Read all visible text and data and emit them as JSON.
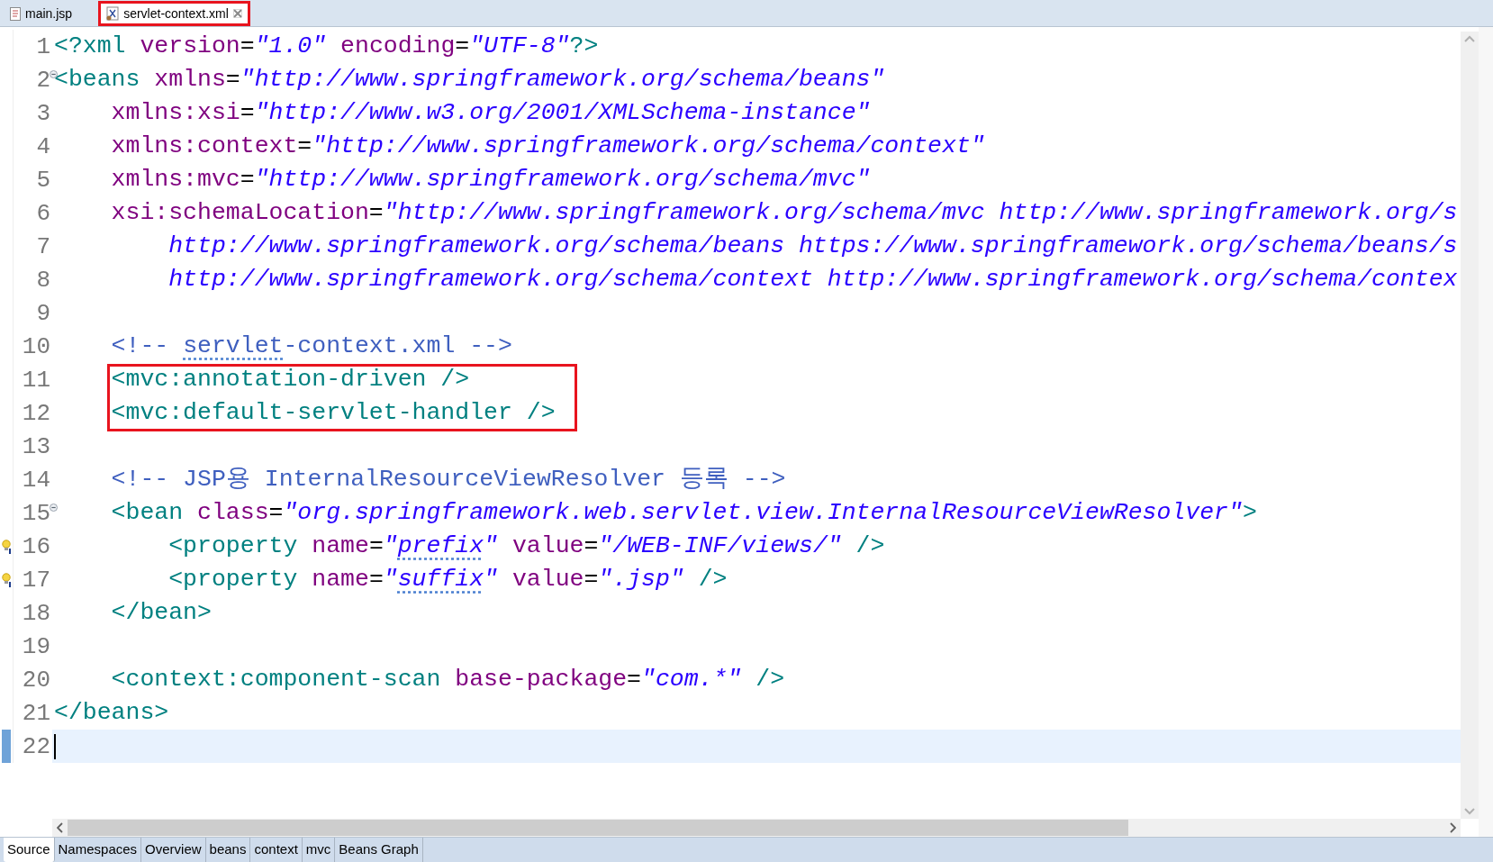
{
  "tabs": [
    {
      "label": "main.jsp",
      "kind": "jsp",
      "selected": false,
      "boxed": false,
      "closable": false
    },
    {
      "label": "servlet-context.xml",
      "kind": "xml",
      "selected": true,
      "boxed": true,
      "closable": true
    }
  ],
  "lines": [
    {
      "number": "1",
      "tokens": [
        {
          "kind": "tag",
          "text": "<?xml"
        },
        {
          "kind": "attr",
          "text": " version"
        },
        {
          "kind": "plain",
          "text": "="
        },
        {
          "kind": "value",
          "text": "\"1.0\""
        },
        {
          "kind": "attr",
          "text": " encoding"
        },
        {
          "kind": "plain",
          "text": "="
        },
        {
          "kind": "value",
          "text": "\"UTF-8\""
        },
        {
          "kind": "tag",
          "text": "?>"
        }
      ]
    },
    {
      "number": "2",
      "foldable": true,
      "tokens": [
        {
          "kind": "tag",
          "text": "<beans"
        },
        {
          "kind": "attr",
          "text": " xmlns"
        },
        {
          "kind": "plain",
          "text": "="
        },
        {
          "kind": "value",
          "text": "\"http://www.springframework.org/schema/beans\""
        }
      ]
    },
    {
      "number": "3",
      "tokens": [
        {
          "kind": "attr",
          "text": "    xmlns:xsi"
        },
        {
          "kind": "plain",
          "text": "="
        },
        {
          "kind": "value",
          "text": "\"http://www.w3.org/2001/XMLSchema-instance\""
        }
      ]
    },
    {
      "number": "4",
      "tokens": [
        {
          "kind": "attr",
          "text": "    xmlns:context"
        },
        {
          "kind": "plain",
          "text": "="
        },
        {
          "kind": "value",
          "text": "\"http://www.springframework.org/schema/context\""
        }
      ]
    },
    {
      "number": "5",
      "tokens": [
        {
          "kind": "attr",
          "text": "    xmlns:mvc"
        },
        {
          "kind": "plain",
          "text": "="
        },
        {
          "kind": "value",
          "text": "\"http://www.springframework.org/schema/mvc\""
        }
      ]
    },
    {
      "number": "6",
      "tokens": [
        {
          "kind": "attr",
          "text": "    xsi:schemaLocation"
        },
        {
          "kind": "plain",
          "text": "="
        },
        {
          "kind": "value",
          "text": "\"http://www.springframework.org/schema/mvc http://www.springframework.org/s"
        }
      ]
    },
    {
      "number": "7",
      "tokens": [
        {
          "kind": "value",
          "text": "        http://www.springframework.org/schema/beans https://www.springframework.org/schema/beans/s"
        }
      ]
    },
    {
      "number": "8",
      "tokens": [
        {
          "kind": "value",
          "text": "        http://www.springframework.org/schema/context http://www.springframework.org/schema/contex"
        }
      ]
    },
    {
      "number": "9"
    },
    {
      "number": "10",
      "tokens": [
        {
          "kind": "comment",
          "text": "    <!-- "
        },
        {
          "kind": "comment",
          "text": "servlet",
          "spell": true
        },
        {
          "kind": "comment",
          "text": "-context.xml -->"
        }
      ]
    },
    {
      "number": "11",
      "boxed": true,
      "tokens": [
        {
          "kind": "tag",
          "text": "    <mvc:annotation-driven />"
        }
      ]
    },
    {
      "number": "12",
      "boxed": true,
      "tokens": [
        {
          "kind": "tag",
          "text": "    <mvc:default-servlet-handler />"
        }
      ]
    },
    {
      "number": "13"
    },
    {
      "number": "14",
      "tokens": [
        {
          "kind": "comment",
          "text": "    <!-- JSP용 InternalResourceViewResolver 등록 -->"
        }
      ]
    },
    {
      "number": "15",
      "foldable": true,
      "tokens": [
        {
          "kind": "tag",
          "text": "    <bean"
        },
        {
          "kind": "attr",
          "text": " class"
        },
        {
          "kind": "plain",
          "text": "="
        },
        {
          "kind": "value",
          "text": "\"org.springframework.web.servlet.view.InternalResourceViewResolver\""
        },
        {
          "kind": "tag",
          "text": ">"
        }
      ]
    },
    {
      "number": "16",
      "hint": true,
      "tokens": [
        {
          "kind": "tag",
          "text": "        <property"
        },
        {
          "kind": "attr",
          "text": " name"
        },
        {
          "kind": "plain",
          "text": "="
        },
        {
          "kind": "value",
          "text": "\""
        },
        {
          "kind": "value",
          "text": "prefix",
          "spell": true
        },
        {
          "kind": "value",
          "text": "\""
        },
        {
          "kind": "attr",
          "text": " value"
        },
        {
          "kind": "plain",
          "text": "="
        },
        {
          "kind": "value",
          "text": "\"/WEB-INF/views/\""
        },
        {
          "kind": "tag",
          "text": " />"
        }
      ]
    },
    {
      "number": "17",
      "hint": true,
      "tokens": [
        {
          "kind": "tag",
          "text": "        <property"
        },
        {
          "kind": "attr",
          "text": " name"
        },
        {
          "kind": "plain",
          "text": "="
        },
        {
          "kind": "value",
          "text": "\""
        },
        {
          "kind": "value",
          "text": "suffix",
          "spell": true
        },
        {
          "kind": "value",
          "text": "\""
        },
        {
          "kind": "attr",
          "text": " value"
        },
        {
          "kind": "plain",
          "text": "="
        },
        {
          "kind": "value",
          "text": "\".jsp\""
        },
        {
          "kind": "tag",
          "text": " />"
        }
      ]
    },
    {
      "number": "18",
      "tokens": [
        {
          "kind": "tag",
          "text": "    </bean>"
        }
      ]
    },
    {
      "number": "19"
    },
    {
      "number": "20",
      "tokens": [
        {
          "kind": "tag",
          "text": "    <context:component-scan"
        },
        {
          "kind": "attr",
          "text": " base-package"
        },
        {
          "kind": "plain",
          "text": "="
        },
        {
          "kind": "value",
          "text": "\"com.*\""
        },
        {
          "kind": "tag",
          "text": " />"
        }
      ]
    },
    {
      "number": "21",
      "tokens": [
        {
          "kind": "tag",
          "text": "</beans>"
        }
      ]
    },
    {
      "number": "22",
      "current": true
    }
  ],
  "bottom_tabs": [
    {
      "label": "Source",
      "selected": true
    },
    {
      "label": "Namespaces",
      "selected": false
    },
    {
      "label": "Overview",
      "selected": false
    },
    {
      "label": "beans",
      "selected": false
    },
    {
      "label": "context",
      "selected": false
    },
    {
      "label": "mvc",
      "selected": false
    },
    {
      "label": "Beans Graph",
      "selected": false
    }
  ]
}
